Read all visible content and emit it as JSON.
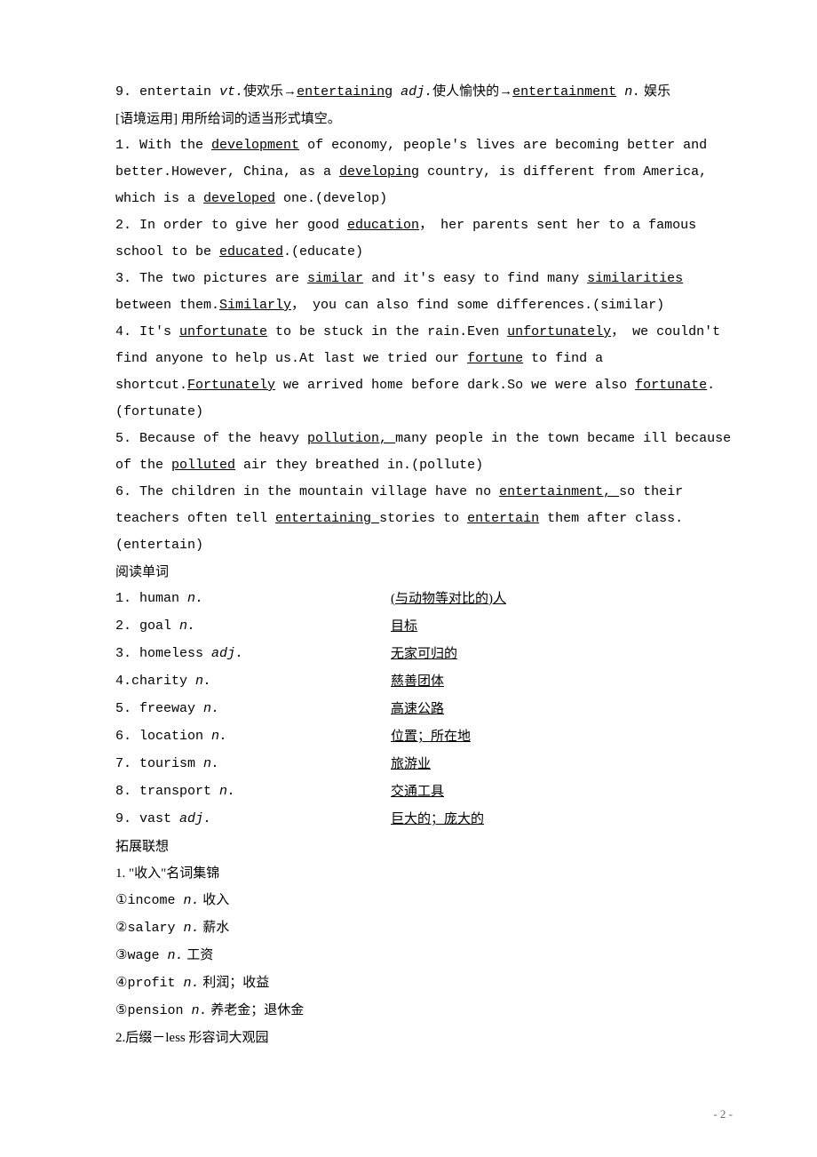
{
  "line9": {
    "prefix": "9. entertain ",
    "pos1": "vt.",
    "cn1": "使欢乐→",
    "u1": "entertaining",
    "space1": " ",
    "pos2": "adj.",
    "cn2": "使人愉快的→",
    "u2": "entertainment",
    "space2": " ",
    "pos3": "n.",
    "cn3": " 娱乐"
  },
  "contextHeader": "[语境运用]  用所给词的适当形式填空。",
  "s1": {
    "a": "1. With the ",
    "b": "development",
    "c": " of economy, people's lives are becoming better and better.However, China, as a ",
    "d": "developing",
    "e": " country, is different from America, which is a ",
    "f": "developed",
    "g": " one.(develop)"
  },
  "s2": {
    "a": "2. In order to give her good ",
    "b": "education",
    "c": "， her parents sent her to a famous school to be ",
    "d": "educated",
    "e": ".(educate)"
  },
  "s3": {
    "a": "3. The two pictures are ",
    "b": "similar",
    "c": " and it's easy to find many ",
    "d": "similarities",
    "e": " between them.",
    "f": "Similarly",
    "g": "， you can also find some differences.(similar)"
  },
  "s4": {
    "a": "4. It's ",
    "b": "unfortunate",
    "c": " to be stuck in the rain.Even ",
    "d": "unfortunately",
    "e": "， we couldn't find anyone to help us.At last we tried our ",
    "f": "fortune",
    "g": " to find a shortcut.",
    "h": "Fortunately",
    "i": " we arrived home before dark.So we were also ",
    "j": "fortunate",
    "k": ".(fortunate)"
  },
  "s5": {
    "a": "5. Because of the heavy ",
    "b": "pollution, ",
    "c": "many people in the town became ill because of the ",
    "d": "polluted",
    "e": " air they breathed in.(pollute)"
  },
  "s6": {
    "a": "6. The children in the mountain village have no ",
    "b": "entertainment, ",
    "c": "so their teachers often tell ",
    "d": "entertaining ",
    "e": "stories to ",
    "f": "entertain",
    "g": " them after class.(entertain)"
  },
  "readingHeader": "阅读单词",
  "vocab": [
    {
      "l": "1. human ",
      "pos": "n.",
      "r": "(与动物等对比的)人"
    },
    {
      "l": "2. goal ",
      "pos": "n.",
      "r": "目标"
    },
    {
      "l": "3. homeless ",
      "pos": "adj.",
      "r": "无家可归的"
    },
    {
      "l": "4.charity ",
      "pos": "n.",
      "r": "慈善团体"
    },
    {
      "l": "5. freeway ",
      "pos": "n.",
      "r": "高速公路"
    },
    {
      "l": "6. location ",
      "pos": "n.",
      "r": "位置；所在地"
    },
    {
      "l": "7. tourism ",
      "pos": "n.",
      "r": "旅游业"
    },
    {
      "l": "8. transport ",
      "pos": "n.",
      "r": "交通工具"
    },
    {
      "l": "9. vast ",
      "pos": "adj.",
      "r": "巨大的；庞大的"
    }
  ],
  "extendHeader": "拓展联想",
  "ext1": {
    "title": "1.  \"收入\"名词集锦",
    "items": [
      {
        "num": "①",
        "w": "income ",
        "pos": "n.",
        "cn": " 收入"
      },
      {
        "num": "②",
        "w": "salary ",
        "pos": "n.",
        "cn": " 薪水"
      },
      {
        "num": "③",
        "w": "wage ",
        "pos": "n.",
        "cn": " 工资"
      },
      {
        "num": "④",
        "w": "profit ",
        "pos": "n.",
        "cn": " 利润；收益"
      },
      {
        "num": "⑤",
        "w": "pension ",
        "pos": "n.",
        "cn": " 养老金；退休金"
      }
    ]
  },
  "ext2title": "2.后缀－less 形容词大观园",
  "pageNumber": "- 2 -"
}
